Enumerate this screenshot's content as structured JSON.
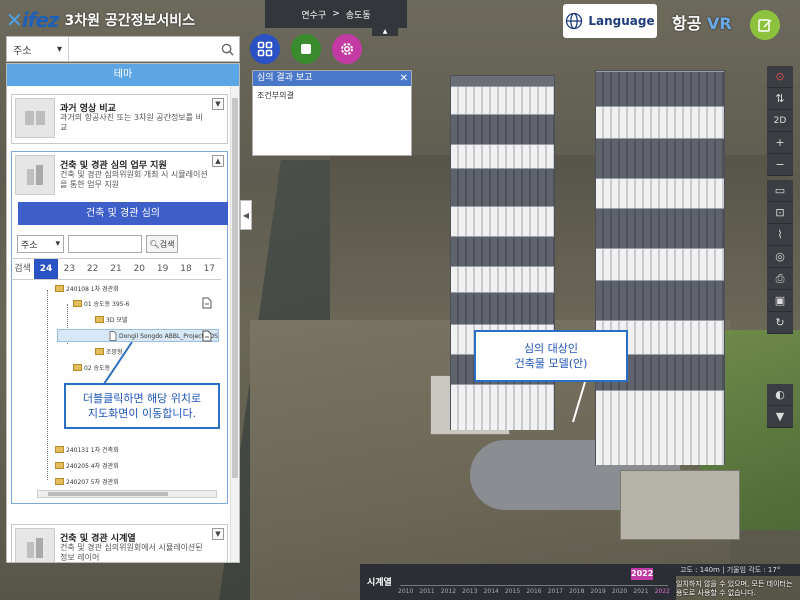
{
  "header": {
    "logo_text": "ifez",
    "service_name": "3차원 공간정보서비스"
  },
  "search": {
    "type_label": "주소",
    "placeholder": ""
  },
  "breadcrumb": {
    "district": "연수구",
    "separator": ">",
    "dong": "송도동"
  },
  "topright": {
    "language_label": "Language",
    "vr_label_ko": "항공",
    "vr_label_en": "VR"
  },
  "panel": {
    "header": "테마",
    "cards": [
      {
        "title": "과거 영상 비교",
        "desc": "과거의 항공사진 또는 3차원 공간정보를 비교",
        "toggle": "▼"
      },
      {
        "title": "건축 및 경관 심의 업무 지원",
        "desc": "건축 및 경관 심의위원회 개최 시 시뮬레이션을 통한 업무 지원",
        "toggle": "▲"
      },
      {
        "title": "건축 및 경관 시계열",
        "desc": "건축 및 경관 심의위원회에서 시뮬레이션된 정보 레이어",
        "toggle": "▼"
      }
    ],
    "review_button": "건축 및 경관 심의",
    "sub_search": {
      "type_label": "주소",
      "button": "검색"
    },
    "year_tabs": [
      {
        "label": "검색",
        "active": false
      },
      {
        "label": "24",
        "active": true
      },
      {
        "label": "23",
        "active": false
      },
      {
        "label": "22",
        "active": false
      },
      {
        "label": "21",
        "active": false
      },
      {
        "label": "20",
        "active": false
      },
      {
        "label": "19",
        "active": false
      },
      {
        "label": "18",
        "active": false
      },
      {
        "label": "17",
        "active": false
      }
    ],
    "tree": [
      "240108 1차 경관회",
      "01 송도동 395-6",
      "3D 모델",
      "Dongil Songdo ABBL_Project.3DS",
      "조망형",
      "02 송도동",
      "240131 1차 건축회",
      "240205 4차 경관회",
      "240207 5차 경관회"
    ]
  },
  "callouts": {
    "tree_hint": [
      "더블클릭하면 해당 위치로",
      "지도화면이 이동합니다."
    ],
    "building_hint": [
      "심의 대상인",
      "건축물 모델(안)"
    ]
  },
  "report": {
    "title": "심의 결과 보고",
    "body": "조건부의결"
  },
  "right_toolbar": {
    "mode": "2D"
  },
  "timeline": {
    "label": "시계열",
    "current_year": "2022",
    "years": [
      "2010",
      "2011",
      "2012",
      "2013",
      "2014",
      "2015",
      "2016",
      "2017",
      "2018",
      "2019",
      "2020",
      "2021",
      "2022"
    ],
    "selected_year": "2022"
  },
  "status": {
    "altitude": "고도 : 140m",
    "tilt": "기울임 각도 : 17°"
  },
  "disclaimer": "일치하지 않을 수 있으며, 모든 데이터는 용도로 사용할 수 없습니다.",
  "colors": {
    "accent_blue": "#3e5ec9",
    "panel_header": "#5da6e6",
    "timeline_marker": "#c43aa5",
    "grid_button": "#2a52c4",
    "stop_button": "#3a8a2e",
    "settings_button": "#c43aa5",
    "edit_button": "#8dc23f"
  }
}
